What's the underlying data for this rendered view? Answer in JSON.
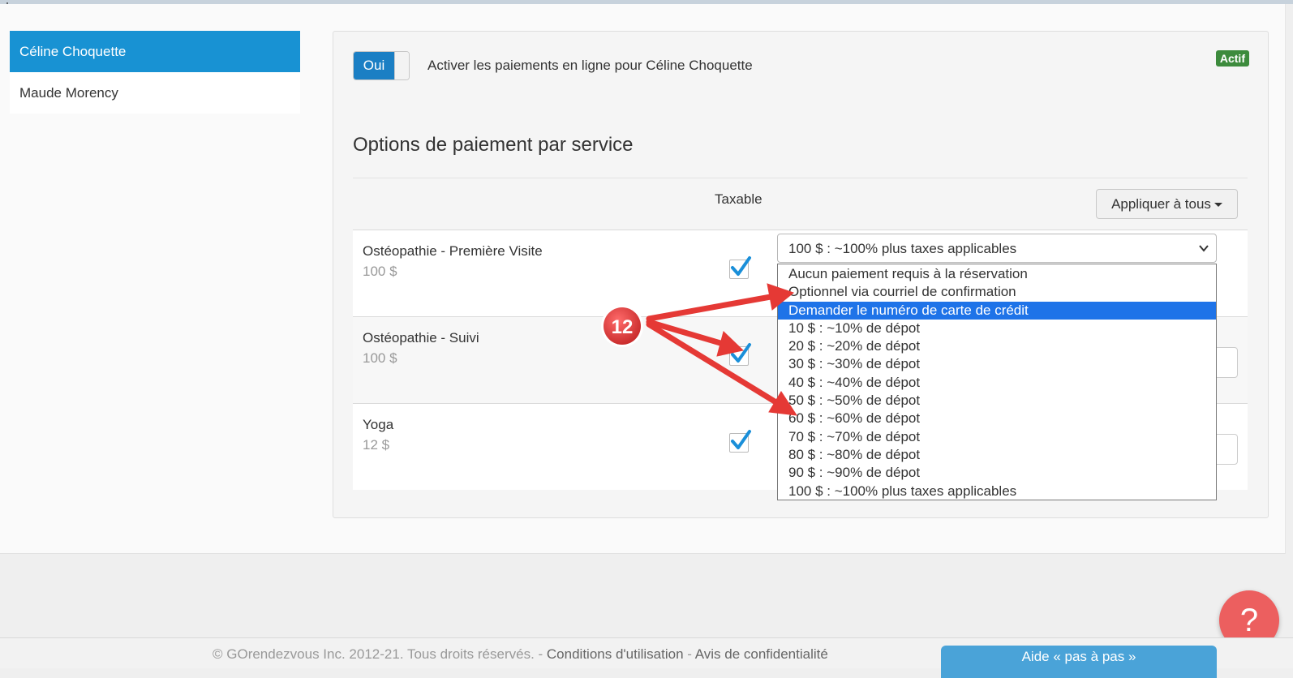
{
  "sidebar": {
    "items": [
      {
        "label": "Céline Choquette",
        "active": true
      },
      {
        "label": "Maude Morency",
        "active": false
      }
    ]
  },
  "panel": {
    "toggle_label": "Oui",
    "activate_label": "Activer les paiements en ligne pour Céline Choquette",
    "status_badge": "Actif",
    "section_title": "Options de paiement par service",
    "table": {
      "header_taxable": "Taxable",
      "apply_all_label": "Appliquer à tous",
      "rows": [
        {
          "name": "Ostéopathie - Première Visite",
          "price": "100 $",
          "taxable": true
        },
        {
          "name": "Ostéopathie - Suivi",
          "price": "100 $",
          "taxable": true
        },
        {
          "name": "Yoga",
          "price": "12 $",
          "taxable": true
        }
      ]
    }
  },
  "payment_select": {
    "current_value": "100 $ : ~100% plus taxes applicables",
    "options": [
      "Aucun paiement requis à la réservation",
      "Optionnel via courriel de confirmation",
      "Demander le numéro de carte de crédit",
      "10 $ : ~10% de dépot",
      "20 $ : ~20% de dépot",
      "30 $ : ~30% de dépot",
      "40 $ : ~40% de dépot",
      "50 $ : ~50% de dépot",
      "60 $ : ~60% de dépot",
      "70 $ : ~70% de dépot",
      "80 $ : ~80% de dépot",
      "90 $ : ~90% de dépot",
      "100 $ : ~100% plus taxes applicables"
    ],
    "highlighted_option": "Demander le numéro de carte de crédit"
  },
  "annotation": {
    "step_number": "12",
    "color": "#e53935"
  },
  "footer": {
    "copyright": "© GOrendezvous Inc. 2012-21. Tous droits réservés. - ",
    "terms_link": "Conditions d'utilisation",
    "separator": " - ",
    "privacy_link": "Avis de confidentialité",
    "help_button": "Aide « pas à pas »",
    "question_icon": "?"
  },
  "colors": {
    "primary": "#1892d3",
    "success_badge": "#3d8b3d",
    "help_fab": "#ec5f5f",
    "checkmark": "#1a8fd9"
  }
}
